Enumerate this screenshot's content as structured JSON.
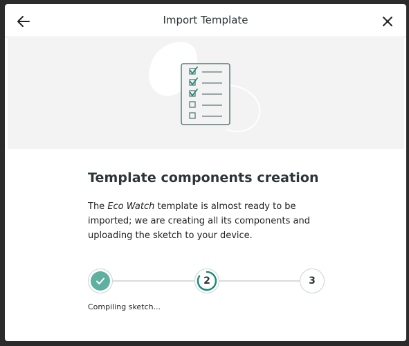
{
  "dialog": {
    "title": "Import Template",
    "back_icon": "arrow-left-icon",
    "close_icon": "close-icon"
  },
  "hero": {
    "illustration": "checklist-clipboard-icon"
  },
  "content": {
    "heading": "Template components creation",
    "text_before": "The ",
    "template_name": "Eco Watch",
    "text_after": " template is almost ready to be imported; we are creating all its components and uploading the sketch to your device."
  },
  "stepper": {
    "steps": [
      {
        "state": "done",
        "icon": "checkmark-icon"
      },
      {
        "state": "active",
        "label": "2"
      },
      {
        "state": "pending",
        "label": "3"
      }
    ],
    "status_text": "Compiling sketch...",
    "accent_color": "#5fb0a0",
    "active_ring_color": "#1d8a7a"
  }
}
